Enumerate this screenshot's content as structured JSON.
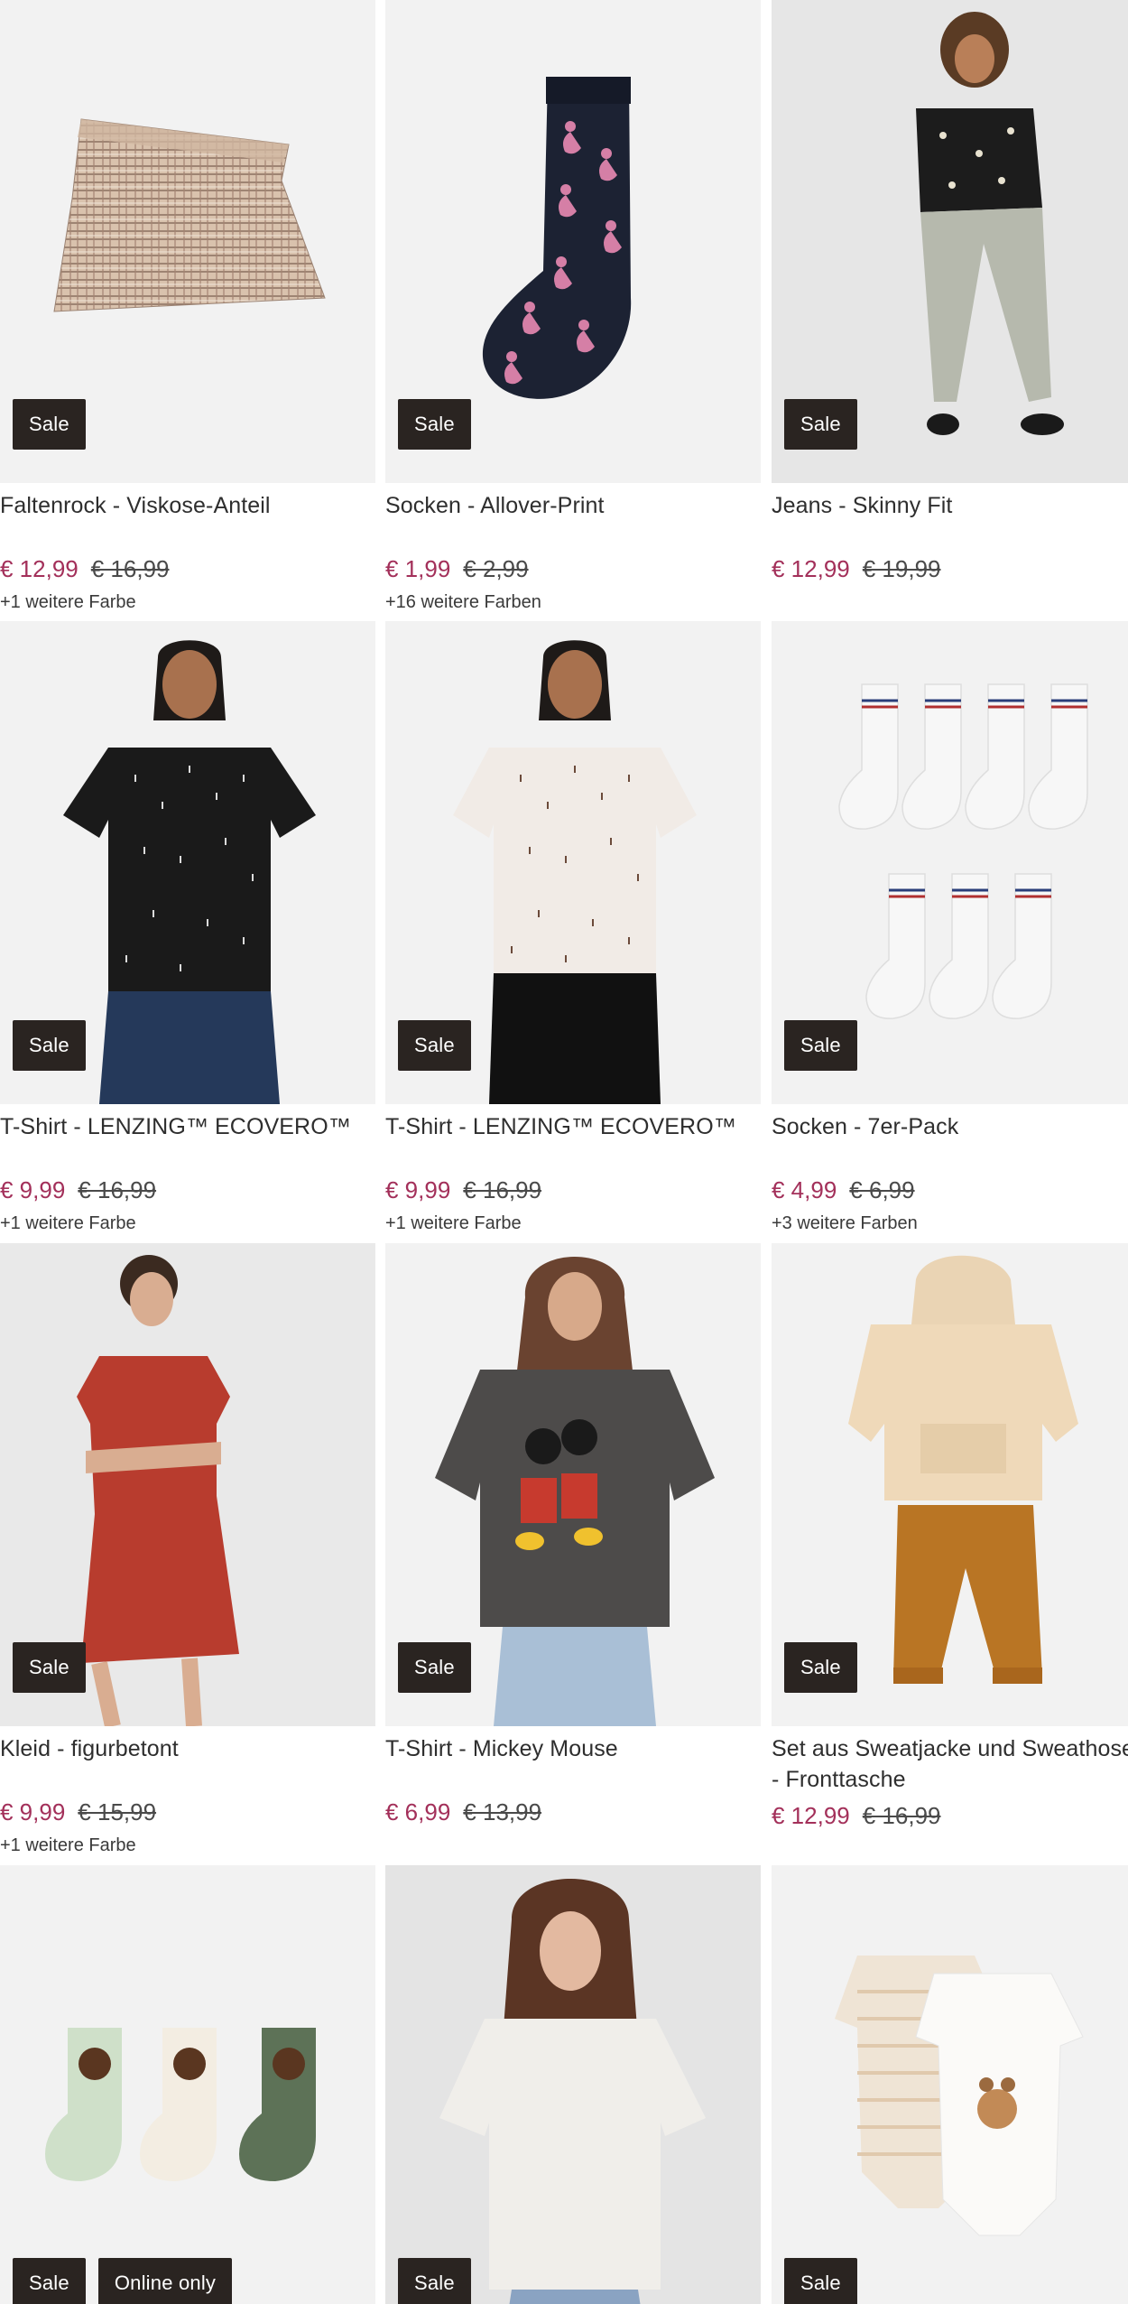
{
  "colors": {
    "sale_price": "#a3305a",
    "badge_bg": "#2a2421",
    "image_bg": "#f2f2f2"
  },
  "products": [
    {
      "title": "Faltenrock - Viskose-Anteil",
      "price": "€ 12,99",
      "old_price": "€ 16,99",
      "colors_note": "+1 weitere Farbe",
      "badges": [
        "Sale"
      ],
      "image": "plaid-skirt"
    },
    {
      "title": "Socken - Allover-Print",
      "price": "€ 1,99",
      "old_price": "€ 2,99",
      "colors_note": "+16 weitere Farben",
      "badges": [
        "Sale"
      ],
      "image": "flamingo-sock"
    },
    {
      "title": "Jeans - Skinny Fit",
      "price": "€ 12,99",
      "old_price": "€ 19,99",
      "colors_note": "",
      "badges": [
        "Sale"
      ],
      "image": "model-jeans"
    },
    {
      "title": "T-Shirt - LENZING™ ECOVERO™",
      "price": "€ 9,99",
      "old_price": "€ 16,99",
      "colors_note": "+1 weitere Farbe",
      "badges": [
        "Sale"
      ],
      "image": "model-black-tshirt"
    },
    {
      "title": "T-Shirt - LENZING™ ECOVERO™",
      "price": "€ 9,99",
      "old_price": "€ 16,99",
      "colors_note": "+1 weitere Farbe",
      "badges": [
        "Sale"
      ],
      "image": "model-white-tshirt"
    },
    {
      "title": "Socken - 7er-Pack",
      "price": "€ 4,99",
      "old_price": "€ 6,99",
      "colors_note": "+3 weitere Farben",
      "badges": [
        "Sale"
      ],
      "image": "white-socks-7pack"
    },
    {
      "title": "Kleid - figurbetont",
      "price": "€ 9,99",
      "old_price": "€ 15,99",
      "colors_note": "+1 weitere Farbe",
      "badges": [
        "Sale"
      ],
      "image": "model-red-dress"
    },
    {
      "title": "T-Shirt - Mickey Mouse",
      "price": "€ 6,99",
      "old_price": "€ 13,99",
      "colors_note": "",
      "badges": [
        "Sale"
      ],
      "image": "model-mickey-tshirt"
    },
    {
      "title": "Set aus Sweatjacke und Sweathose - Fronttasche",
      "price": "€ 12,99",
      "old_price": "€ 16,99",
      "colors_note": "",
      "badges": [
        "Sale"
      ],
      "image": "kids-hoodie-set"
    },
    {
      "title": "",
      "price": "",
      "old_price": "",
      "colors_note": "",
      "badges": [
        "Sale",
        "Online only"
      ],
      "image": "bear-socks"
    },
    {
      "title": "",
      "price": "",
      "old_price": "",
      "colors_note": "",
      "badges": [
        "Sale"
      ],
      "image": "model-white-top"
    },
    {
      "title": "",
      "price": "",
      "old_price": "",
      "colors_note": "",
      "badges": [
        "Sale"
      ],
      "image": "baby-bodysuits"
    }
  ]
}
